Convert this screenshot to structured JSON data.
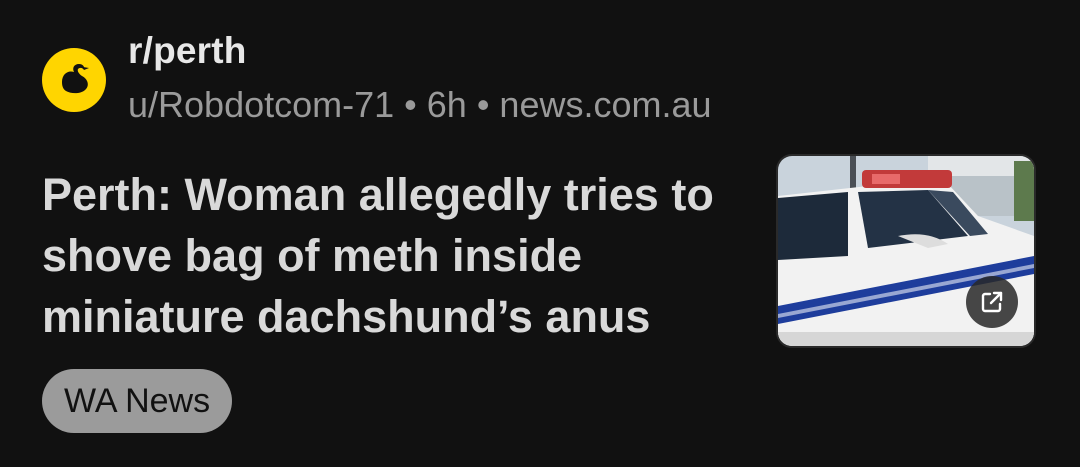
{
  "post": {
    "subreddit": "r/perth",
    "author": "u/Robdotcom-71",
    "age": "6h",
    "domain": "news.com.au",
    "separator": "•",
    "title": "Perth: Woman allegedly tries to shove bag of meth inside miniature dachshund’s anus",
    "flair": "WA News",
    "avatar_icon": "black-swan-icon",
    "thumbnail_icon": "external-link-icon"
  },
  "colors": {
    "background": "#111111",
    "avatar": "#ffd500",
    "flair_bg": "#9b9b9b",
    "meta_text": "#9a9a9a"
  }
}
